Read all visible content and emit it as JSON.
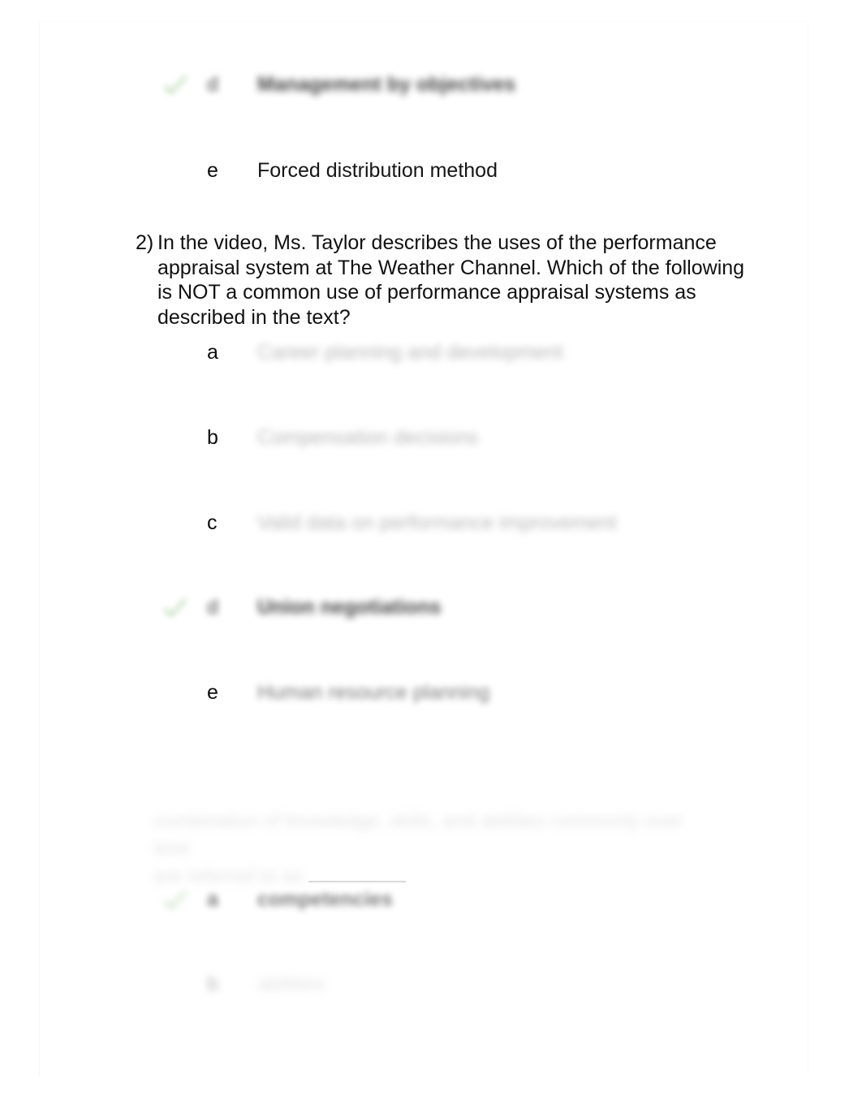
{
  "document": {
    "type": "quiz-answer-key",
    "page_background": "#ffffff",
    "sheet_background": "#ffffff",
    "text_color": "#111111",
    "check_color": "#7cb56b"
  },
  "question_1_tail": {
    "options": [
      {
        "letter": "d",
        "text": "Management by objectives",
        "correct": true,
        "legible": false,
        "blur": "heavy"
      },
      {
        "letter": "e",
        "text": "Forced distribution method",
        "correct": false,
        "legible": true,
        "blur": "none"
      }
    ]
  },
  "question_2": {
    "number": "2)",
    "text": "In the video, Ms. Taylor describes the uses of the performance appraisal system at The Weather Channel. Which of the following is NOT a common use of performance appraisal systems as described in the text?",
    "legible": true,
    "options": [
      {
        "letter": "a",
        "text": "Career planning and development",
        "correct": false,
        "legible": false,
        "blur": "light"
      },
      {
        "letter": "b",
        "text": "Compensation decisions",
        "correct": false,
        "legible": false,
        "blur": "light"
      },
      {
        "letter": "c",
        "text": "Valid data on performance improvement",
        "correct": false,
        "legible": false,
        "blur": "light"
      },
      {
        "letter": "d",
        "text": "Union negotiations",
        "correct": true,
        "legible": false,
        "blur": "heavy"
      },
      {
        "letter": "e",
        "text": "Human resource planning",
        "correct": false,
        "legible": false,
        "blur": "mid"
      }
    ]
  },
  "question_3": {
    "stem_line_1": "combination of knowledge, skills, and abilities commonly over time",
    "stem_line_2": "are referred to as",
    "stem_blank": "____________",
    "legible": false,
    "options": [
      {
        "letter": "a",
        "text": "competencies",
        "correct": true,
        "legible": false,
        "blur": "mid"
      },
      {
        "letter": "b",
        "text": "abilities",
        "correct": false,
        "legible": false,
        "blur": "vfaint"
      }
    ]
  },
  "icons": {
    "correct_check": "check-mark-icon"
  }
}
